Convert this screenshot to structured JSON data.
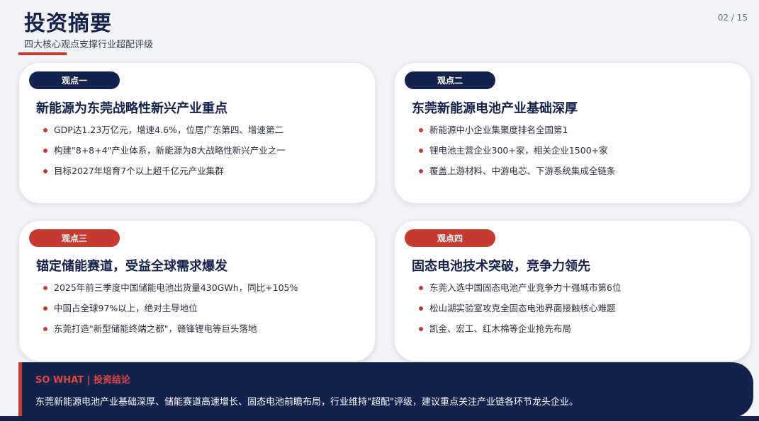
{
  "header": {
    "title": "投资摘要",
    "subtitle": "四大核心观点支撑行业超配评级",
    "page_number": "02 / 15"
  },
  "colors": {
    "navy": "#14224e",
    "accent_red": "#c73a2f"
  },
  "cards": [
    {
      "tag": "观点一",
      "title": "新能源为东莞战略性新兴产业重点",
      "bullets": [
        "GDP达1.23万亿元，增速4.6%，位居广东第四、增速第二",
        "构建\"8+8+4\"产业体系，新能源为8大战略性新兴产业之一",
        "目标2027年培育7个以上超千亿元产业集群"
      ]
    },
    {
      "tag": "观点二",
      "title": "东莞新能源电池产业基础深厚",
      "bullets": [
        "新能源中小企业集聚度排名全国第1",
        "锂电池主营企业300+家，相关企业1500+家",
        "覆盖上游材料、中游电芯、下游系统集成全链条"
      ]
    },
    {
      "tag": "观点三",
      "title": "锚定储能赛道，受益全球需求爆发",
      "bullets": [
        "2025年前三季度中国储能电池出货量430GWh，同比+105%",
        "中国占全球97%以上，绝对主导地位",
        "东莞打造\"新型储能终端之都\"，赣锋锂电等巨头落地"
      ]
    },
    {
      "tag": "观点四",
      "title": "固态电池技术突破，竞争力领先",
      "bullets": [
        "东莞入选中国固态电池产业竞争力十强城市第6位",
        "松山湖实验室攻克全固态电池界面接触核心难题",
        "凯金、宏工、红木棉等企业抢先布局"
      ]
    }
  ],
  "so_what": {
    "label": "SO WHAT | 投资结论",
    "text": "东莞新能源电池产业基础深厚、储能赛道高速增长、固态电池前瞻布局，行业维持\"超配\"评级，建议重点关注产业链各环节龙头企业。"
  }
}
